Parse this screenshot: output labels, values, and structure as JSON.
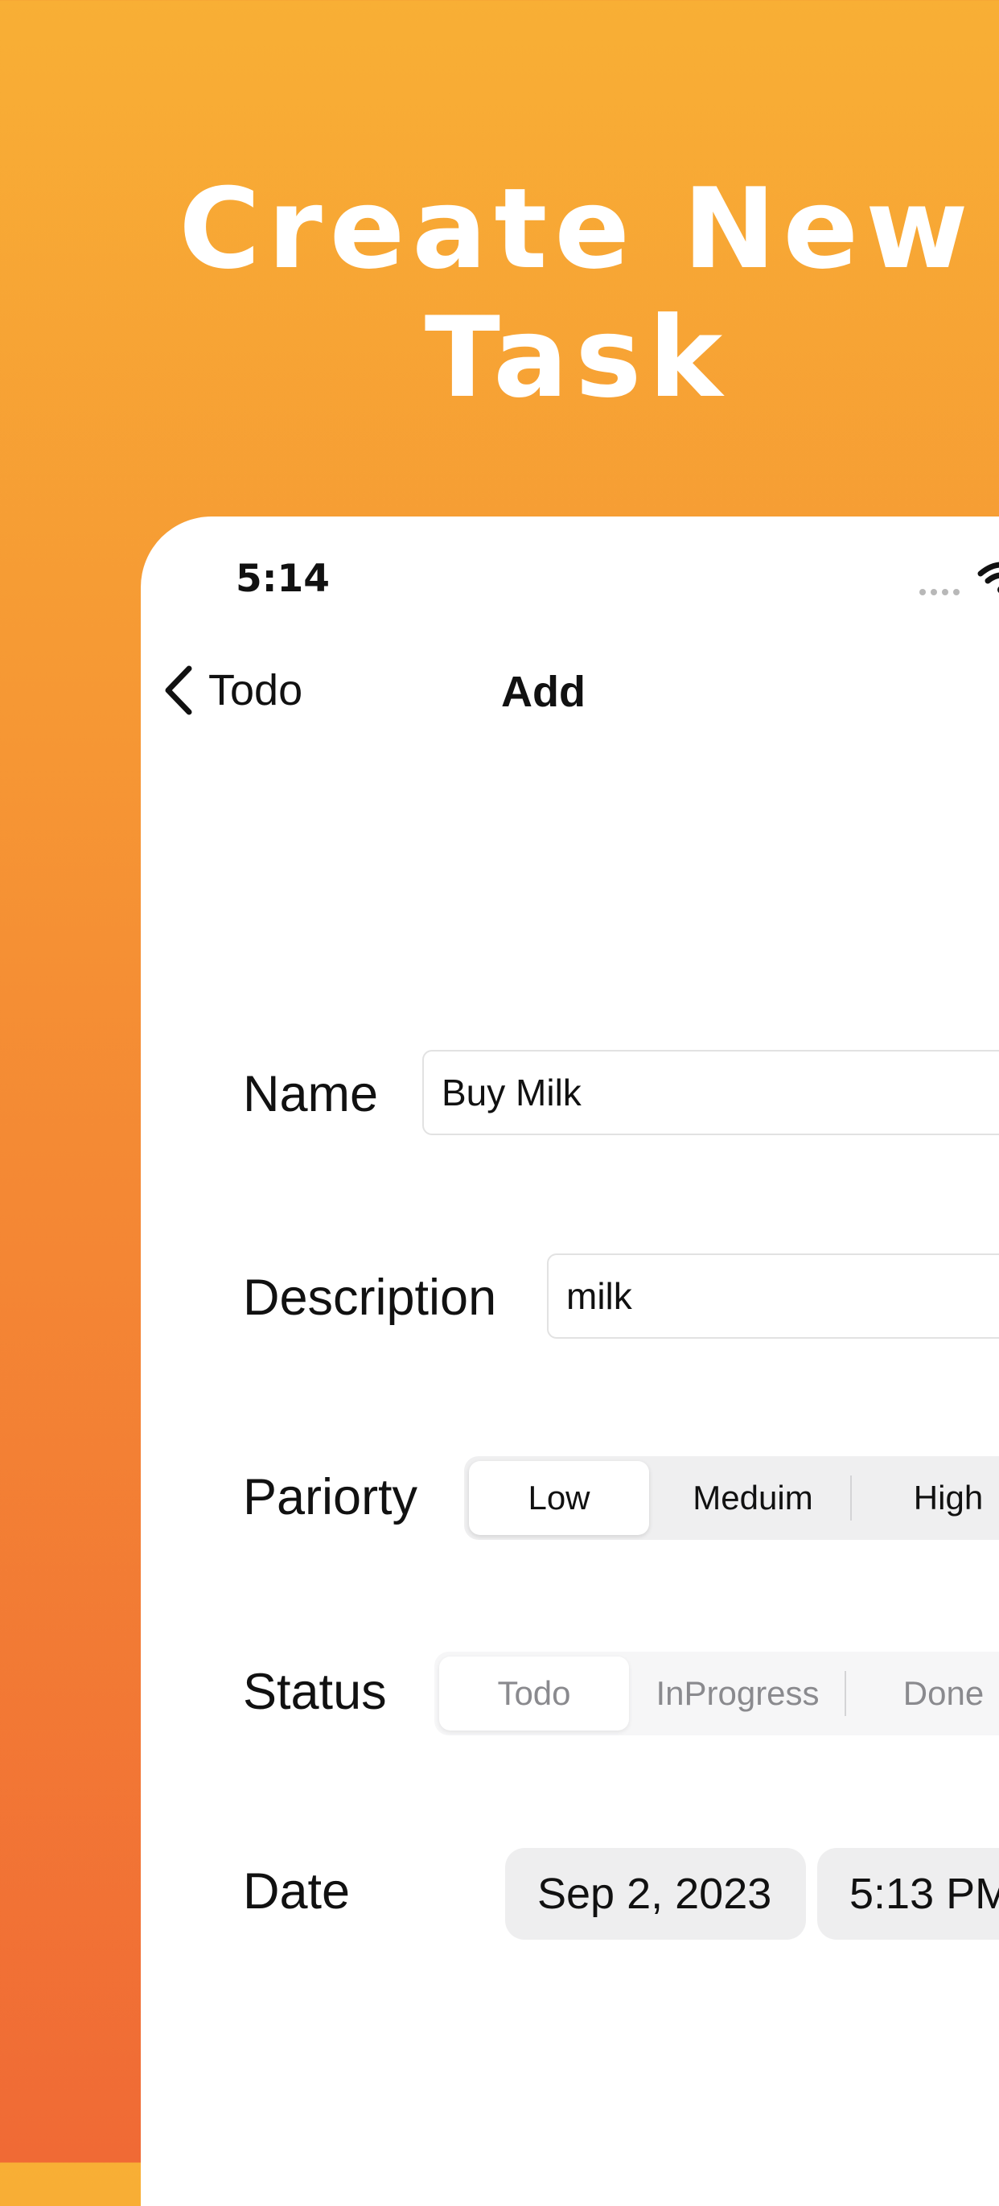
{
  "headline": {
    "line1": "Create New",
    "line2": "Task"
  },
  "status_bar": {
    "time": "5:14"
  },
  "nav": {
    "back_label": "Todo",
    "title": "Add"
  },
  "form": {
    "name": {
      "label": "Name",
      "value": "Buy Milk"
    },
    "description": {
      "label": "Description",
      "value": "milk"
    },
    "priority": {
      "label": "Pariorty",
      "options": [
        "Low",
        "Meduim",
        "High"
      ],
      "selected": "Low"
    },
    "status": {
      "label": "Status",
      "options": [
        "Todo",
        "InProgress",
        "Done"
      ],
      "selected": "Todo"
    },
    "date": {
      "label": "Date",
      "date_value": "Sep 2, 2023",
      "time_value": "5:13 PM"
    }
  },
  "colors": {
    "gradient_top": "#F8AF35",
    "gradient_bottom": "#F06A35",
    "card": "#FFFFFF",
    "text": "#111111",
    "segment_background": "#EFEFF0"
  }
}
